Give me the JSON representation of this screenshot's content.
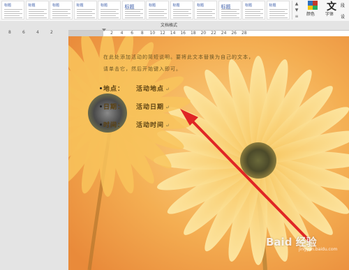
{
  "ribbon": {
    "style_gallery": [
      {
        "label": "标题",
        "big": false
      },
      {
        "label": "标题",
        "big": false
      },
      {
        "label": "标题",
        "big": false
      },
      {
        "label": "标题",
        "big": false
      },
      {
        "label": "标题",
        "big": false
      },
      {
        "label": "标题",
        "big": true
      },
      {
        "label": "标题",
        "big": false
      },
      {
        "label": "标题",
        "big": false
      },
      {
        "label": "标题",
        "big": false
      },
      {
        "label": "标题",
        "big": true
      },
      {
        "label": "标题",
        "big": false
      },
      {
        "label": "标题",
        "big": false
      }
    ],
    "colors_label": "颜色",
    "fonts_glyph": "文",
    "fonts_label": "字体",
    "side_top_label": "段",
    "side_bottom_label": "设",
    "swatch_colors": [
      "#2e6fbd",
      "#c0392b",
      "#f1c40f",
      "#27ae60"
    ]
  },
  "group_label": "文档格式",
  "ruler": {
    "outside_left_numbers": [
      "8",
      "6",
      "4",
      "2"
    ],
    "numbers": [
      "2",
      "4",
      "6",
      "8",
      "10",
      "12",
      "14",
      "16",
      "18",
      "20",
      "22",
      "24",
      "26",
      "28"
    ]
  },
  "document": {
    "intro_line_1": "在此处添加活动的简短说明。要将此文本替换为自己的文本，",
    "intro_line_2": "请单击它，然后开始键入即可。",
    "location_label": "地点：",
    "location_value": "活动地点",
    "date_label": "日期：",
    "date_value": "活动日期",
    "time_label": "时间：",
    "time_value": "活动时间",
    "para_mark": "↵"
  },
  "watermark": {
    "text": "Baid 经验",
    "sub": "jingyan.baidu.com"
  },
  "colors": {
    "arrow": "#e02525",
    "petal_light": "#fbe6a0",
    "petal_mid": "#f6c35a",
    "background": "#f4a846"
  }
}
